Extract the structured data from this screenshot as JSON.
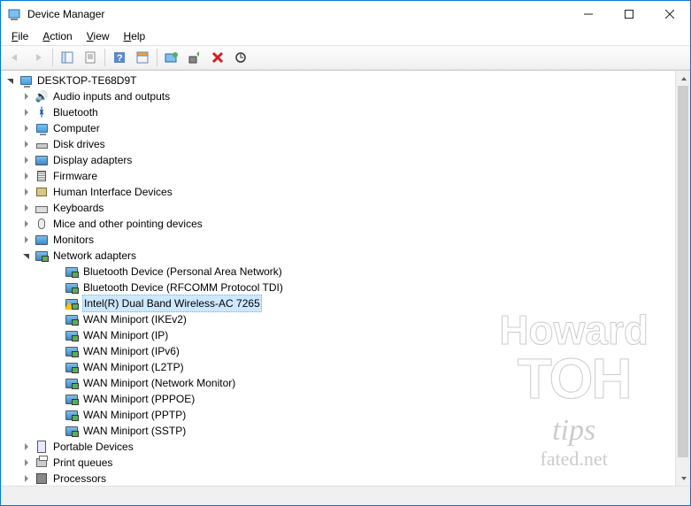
{
  "window": {
    "title": "Device Manager"
  },
  "menu": {
    "file": "File",
    "action": "Action",
    "view": "View",
    "help": "Help"
  },
  "toolbar": {
    "back": "Back",
    "forward": "Forward",
    "showhide": "Show/Hide Console Tree",
    "properties": "Properties",
    "help": "Help",
    "actioncenter": "Action Center",
    "scan": "Scan for hardware changes",
    "update": "Update driver",
    "uninstall": "Uninstall device",
    "enable": "Enable device"
  },
  "tree": {
    "root": "DESKTOP-TE68D9T",
    "categories": [
      {
        "label": "Audio inputs and outputs",
        "icon": "audio"
      },
      {
        "label": "Bluetooth",
        "icon": "bt"
      },
      {
        "label": "Computer",
        "icon": "computer"
      },
      {
        "label": "Disk drives",
        "icon": "drive"
      },
      {
        "label": "Display adapters",
        "icon": "monitor"
      },
      {
        "label": "Firmware",
        "icon": "fw"
      },
      {
        "label": "Human Interface Devices",
        "icon": "hid"
      },
      {
        "label": "Keyboards",
        "icon": "kb"
      },
      {
        "label": "Mice and other pointing devices",
        "icon": "mouse"
      },
      {
        "label": "Monitors",
        "icon": "monitor"
      },
      {
        "label": "Network adapters",
        "icon": "net",
        "expanded": true,
        "children": [
          {
            "label": "Bluetooth Device (Personal Area Network)",
            "icon": "net"
          },
          {
            "label": "Bluetooth Device (RFCOMM Protocol TDI)",
            "icon": "net"
          },
          {
            "label": "Intel(R) Dual Band Wireless-AC 7265",
            "icon": "net-warn",
            "selected": true
          },
          {
            "label": "WAN Miniport (IKEv2)",
            "icon": "net"
          },
          {
            "label": "WAN Miniport (IP)",
            "icon": "net"
          },
          {
            "label": "WAN Miniport (IPv6)",
            "icon": "net"
          },
          {
            "label": "WAN Miniport (L2TP)",
            "icon": "net"
          },
          {
            "label": "WAN Miniport (Network Monitor)",
            "icon": "net"
          },
          {
            "label": "WAN Miniport (PPPOE)",
            "icon": "net"
          },
          {
            "label": "WAN Miniport (PPTP)",
            "icon": "net"
          },
          {
            "label": "WAN Miniport (SSTP)",
            "icon": "net"
          }
        ]
      },
      {
        "label": "Portable Devices",
        "icon": "portable"
      },
      {
        "label": "Print queues",
        "icon": "printer"
      },
      {
        "label": "Processors",
        "icon": "cpu"
      }
    ]
  },
  "watermark": {
    "line1": "Howard",
    "line2": "TOH",
    "line3": "tips",
    "line4": "fated.net"
  }
}
